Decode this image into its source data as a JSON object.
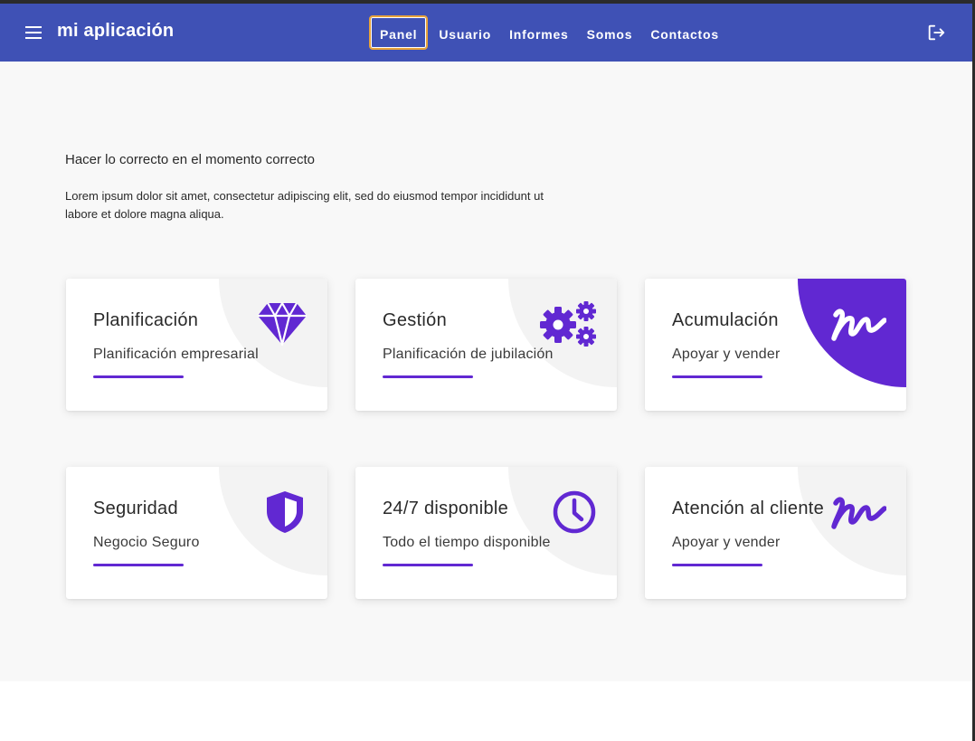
{
  "app": {
    "title": "mi aplicación"
  },
  "nav": {
    "links": [
      {
        "label": "Panel",
        "active": true
      },
      {
        "label": "Usuario"
      },
      {
        "label": "Informes"
      },
      {
        "label": "Somos"
      },
      {
        "label": "Contactos"
      }
    ]
  },
  "hero": {
    "heading": "Hacer lo correcto en el momento correcto",
    "text": "Lorem ipsum dolor sit amet, consectetur adipiscing elit, sed do eiusmod tempor incididunt ut labore et dolore magna aliqua."
  },
  "cards": [
    {
      "title": "Planificación",
      "subtitle": "Planificación empresarial",
      "icon": "diamond-icon"
    },
    {
      "title": "Gestión",
      "subtitle": "Planificación de jubilación",
      "icon": "gears-icon"
    },
    {
      "title": "Acumulación",
      "subtitle": "Apoyar y vender",
      "icon": "signature-icon"
    },
    {
      "title": "Seguridad",
      "subtitle": "Negocio Seguro",
      "icon": "shield-icon"
    },
    {
      "title": "24/7 disponible",
      "subtitle": "Todo el tiempo disponible",
      "icon": "clock-icon"
    },
    {
      "title": "Atención al cliente",
      "subtitle": "Apoyar y vender",
      "icon": "signature-icon"
    }
  ],
  "colors": {
    "primary": "#3f51b5",
    "accent": "#6128d2",
    "background": "#f8f8f8",
    "focus": "#e8a33a"
  }
}
